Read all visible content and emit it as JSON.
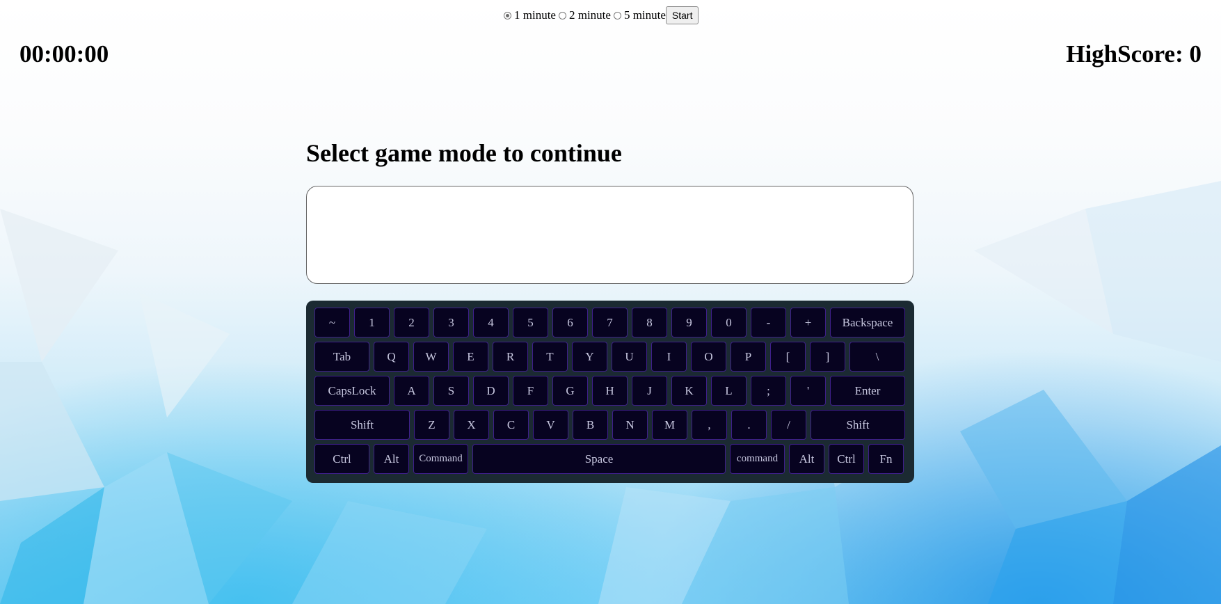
{
  "mode_selector": {
    "options": [
      {
        "label": "1 minute",
        "checked": true
      },
      {
        "label": "2 minute",
        "checked": false
      },
      {
        "label": "5 minute",
        "checked": false
      }
    ],
    "start_label": "Start"
  },
  "timer": "00:00:00",
  "highscore": "HighScore: 0",
  "heading": "Select game mode to continue",
  "typing_box": {
    "value": ""
  },
  "keyboard": {
    "rows": [
      [
        {
          "label": "~"
        },
        {
          "label": "1"
        },
        {
          "label": "2"
        },
        {
          "label": "3"
        },
        {
          "label": "4"
        },
        {
          "label": "5"
        },
        {
          "label": "6"
        },
        {
          "label": "7"
        },
        {
          "label": "8"
        },
        {
          "label": "9"
        },
        {
          "label": "0"
        },
        {
          "label": "-"
        },
        {
          "label": "+"
        },
        {
          "label": "Backspace"
        }
      ],
      [
        {
          "label": "Tab"
        },
        {
          "label": "Q"
        },
        {
          "label": "W"
        },
        {
          "label": "E"
        },
        {
          "label": "R"
        },
        {
          "label": "T"
        },
        {
          "label": "Y"
        },
        {
          "label": "U"
        },
        {
          "label": "I"
        },
        {
          "label": "O"
        },
        {
          "label": "P"
        },
        {
          "label": "["
        },
        {
          "label": "]"
        },
        {
          "label": "\\"
        }
      ],
      [
        {
          "label": "CapsLock"
        },
        {
          "label": "A"
        },
        {
          "label": "S"
        },
        {
          "label": "D"
        },
        {
          "label": "F"
        },
        {
          "label": "G"
        },
        {
          "label": "H"
        },
        {
          "label": "J"
        },
        {
          "label": "K"
        },
        {
          "label": "L"
        },
        {
          "label": ";"
        },
        {
          "label": "'"
        },
        {
          "label": "Enter"
        }
      ],
      [
        {
          "label": "Shift"
        },
        {
          "label": "Z"
        },
        {
          "label": "X"
        },
        {
          "label": "C"
        },
        {
          "label": "V"
        },
        {
          "label": "B"
        },
        {
          "label": "N"
        },
        {
          "label": "M"
        },
        {
          "label": ","
        },
        {
          "label": "."
        },
        {
          "label": "/"
        },
        {
          "label": "Shift"
        }
      ],
      [
        {
          "label": "Ctrl"
        },
        {
          "label": "Alt"
        },
        {
          "label": "Command"
        },
        {
          "label": "Space"
        },
        {
          "label": "command"
        },
        {
          "label": "Alt"
        },
        {
          "label": "Ctrl"
        },
        {
          "label": "Fn"
        }
      ]
    ]
  },
  "colors": {
    "keyboard_bg": "#1b2a32",
    "key_bg": "#070320",
    "key_border": "#3e1f8a",
    "key_text": "#c8c8e0"
  }
}
